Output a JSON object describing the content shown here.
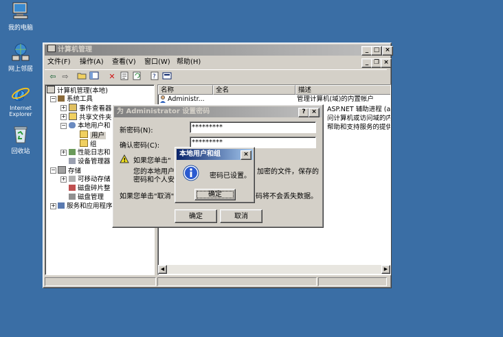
{
  "desktop": {
    "icons": [
      {
        "label": "我的电脑"
      },
      {
        "label": "网上邻居"
      },
      {
        "label_line1": "Internet",
        "label_line2": "Explorer"
      },
      {
        "label": "回收站"
      }
    ]
  },
  "mmc": {
    "title": "计算机管理",
    "menu": [
      "文件(F)",
      "操作(A)",
      "查看(V)",
      "窗口(W)",
      "帮助(H)"
    ],
    "tree": {
      "root": "计算机管理(本地)",
      "system_tools": "系统工具",
      "event_viewer": "事件查看器",
      "shared_folders": "共享文件夹",
      "local_users": "本地用户和",
      "users": "用户",
      "groups": "组",
      "perf_logs": "性能日志和",
      "device_manager": "设备管理器",
      "storage": "存储",
      "removable": "可移动存储",
      "defrag": "磁盘碎片整",
      "disk_mgmt": "磁盘管理",
      "services": "服务和应用程序"
    },
    "columns": [
      "名称",
      "全名",
      "描述"
    ],
    "rows": [
      {
        "name": "Administr...",
        "fullname": "",
        "desc": "管理计算机(域)的内置帐户"
      },
      {
        "name": "",
        "fullname": "",
        "desc": "ASP.NET 辅助进程 (as"
      },
      {
        "name": "",
        "fullname": "",
        "desc": "问计算机或访问域的内"
      },
      {
        "name": "",
        "fullname": "",
        "desc": "帮助和支持服务的提供"
      }
    ]
  },
  "set_password_dialog": {
    "title": "为 Administrator 设置密码",
    "new_password_label": "新密码(N):",
    "new_password_value": "*********",
    "confirm_label": "确认密码(C):",
    "confirm_value": "*********",
    "warning_line1": "如果您单击\"",
    "warning_right1": "加密的文件，保存的",
    "warning_line2": "您的本地用户",
    "warning_line3": "密码和个人安",
    "cancel_note_left": "如果您单击\"取消\"",
    "cancel_note_right": "码将不会丢失数据。",
    "ok_label": "确定",
    "cancel_label": "取消"
  },
  "message_box": {
    "title": "本地用户和组",
    "message": "密码已设置。",
    "ok_label": "确定"
  },
  "colors": {
    "desktop": "#3a6ea5",
    "title_active": "#0a246a",
    "title_inactive": "#808080",
    "face": "#d4d0c8"
  }
}
